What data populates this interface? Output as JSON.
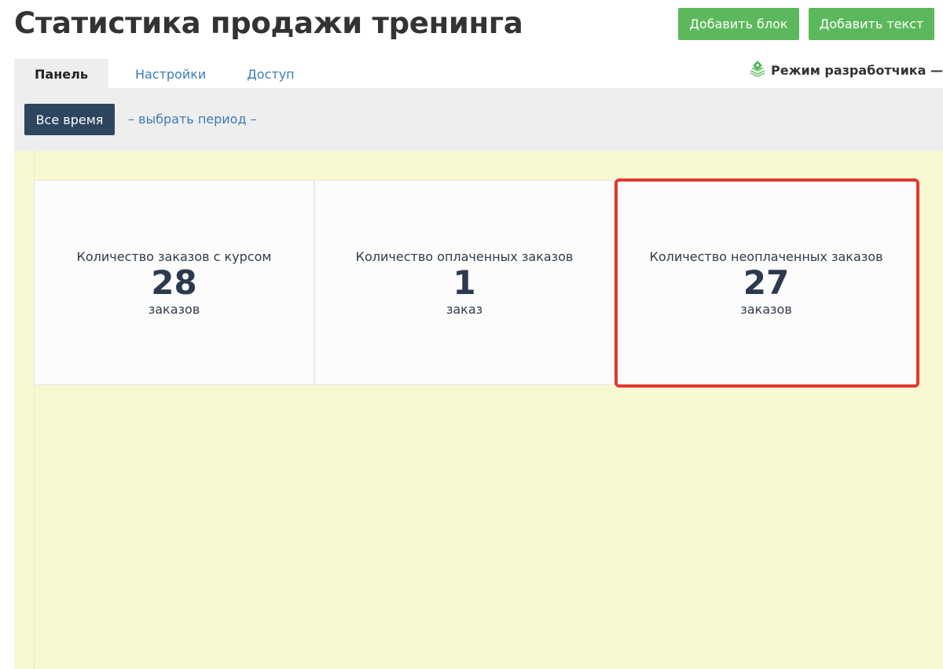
{
  "header": {
    "title": "Статистика продажи тренинга",
    "add_block_label": "Добавить блок",
    "add_text_label": "Добавить текст"
  },
  "tabs": [
    {
      "label": "Панель",
      "active": true
    },
    {
      "label": "Настройки",
      "active": false
    },
    {
      "label": "Доступ",
      "active": false
    }
  ],
  "dev_mode": {
    "label": "Режим разработчика — да",
    "icon": "layers-gear-icon"
  },
  "filter": {
    "all_time_label": "Все время",
    "choose_period_label": "– выбрать период –"
  },
  "cards": [
    {
      "label": "Количество заказов с курсом",
      "value": "28",
      "unit": "заказов"
    },
    {
      "label": "Количество оплаченных заказов",
      "value": "1",
      "unit": "заказ"
    },
    {
      "label": "Количество неоплаченных заказов",
      "value": "27",
      "unit": "заказов",
      "highlighted": true
    }
  ],
  "colors": {
    "accent_green": "#5cb85c",
    "dark_button": "#2e4560",
    "link_blue": "#3c7bb5",
    "content_background": "#f8f9d1",
    "highlight_red": "#e03a2f"
  }
}
